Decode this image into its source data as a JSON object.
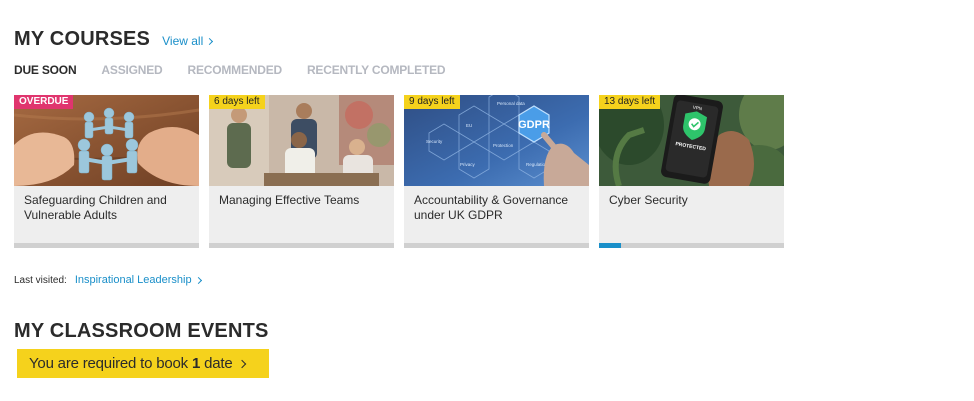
{
  "courses": {
    "title": "MY COURSES",
    "view_all": "View all",
    "tabs": [
      {
        "label": "DUE SOON",
        "active": true
      },
      {
        "label": "ASSIGNED",
        "active": false
      },
      {
        "label": "RECOMMENDED",
        "active": false
      },
      {
        "label": "RECENTLY COMPLETED",
        "active": false
      }
    ],
    "cards": [
      {
        "badge": "OVERDUE",
        "badge_type": "overdue",
        "title": "Safeguarding Children and Vulnerable Adults",
        "progress": 0,
        "image": "paper-chain-people-in-hands"
      },
      {
        "badge": "6 days left",
        "badge_type": "days",
        "title": "Managing Effective Teams",
        "progress": 0,
        "image": "team-meeting-photo"
      },
      {
        "badge": "9 days left",
        "badge_type": "days",
        "title": "Accountability & Governance under UK GDPR",
        "progress": 0,
        "image": "gdpr-hexagon-graphic",
        "image_text": {
          "main": "GDPR",
          "items": [
            "Personal data",
            "EU",
            "Protection",
            "Privacy",
            "Regulation",
            "Security"
          ]
        }
      },
      {
        "badge": "13 days left",
        "badge_type": "days",
        "title": "Cyber Security",
        "progress": 0.12,
        "image": "phone-vpn-protected",
        "image_text": {
          "vpn": "VPN",
          "protected": "PROTECTED"
        }
      }
    ]
  },
  "last_visited": {
    "label": "Last visited:",
    "link": "Inspirational Leadership"
  },
  "events": {
    "title": "MY CLASSROOM EVENTS",
    "banner_prefix": "You are required to book",
    "banner_count": "1",
    "banner_suffix": "date"
  },
  "colors": {
    "accent": "#1a8fc9",
    "overdue": "#e0356e",
    "warning_yellow": "#f5d21c",
    "card_bg": "#eeeeee"
  }
}
